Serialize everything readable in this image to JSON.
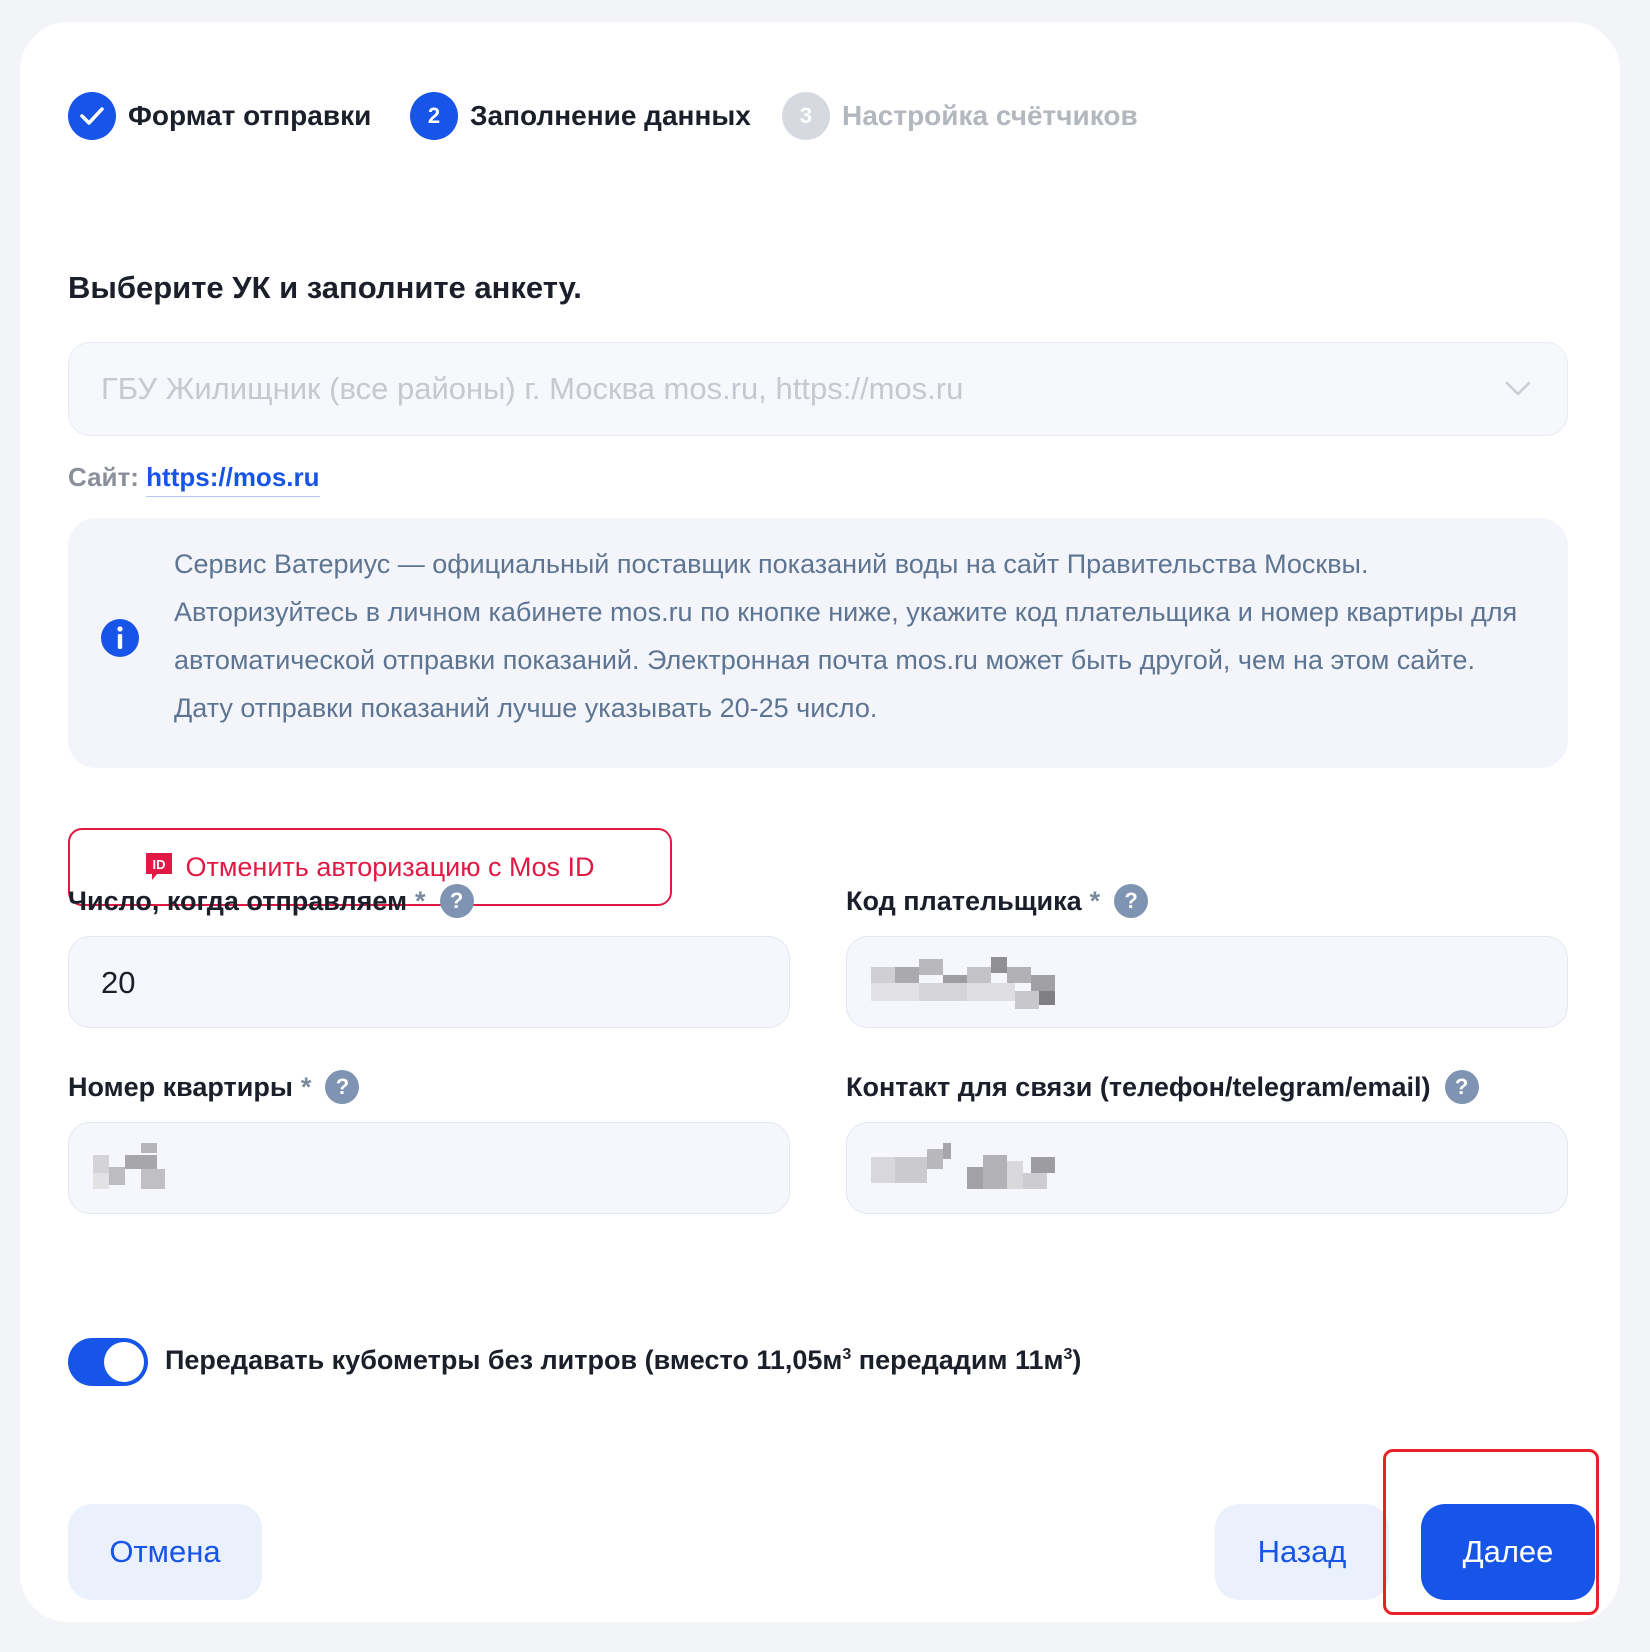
{
  "stepper": {
    "steps": [
      {
        "number": "",
        "label": "Формат отправки",
        "state": "done"
      },
      {
        "number": "2",
        "label": "Заполнение данных",
        "state": "active"
      },
      {
        "number": "3",
        "label": "Настройка счётчиков",
        "state": "pending"
      }
    ]
  },
  "form": {
    "heading": "Выберите УК и заполните анкету.",
    "company_select": {
      "value": "ГБУ Жилищник (все районы) г. Москва mos.ru, https://mos.ru"
    },
    "site": {
      "label": "Сайт:",
      "link": "https://mos.ru"
    },
    "info_text": "Сервис Ватериус — официальный поставщик показаний воды на сайт Правительства Москвы. Авторизуйтесь в личном кабинете mos.ru по кнопке ниже, укажите код плательщика и номер квартиры для автоматической отправки показаний. Электронная почта mos.ru может быть другой, чем на этом сайте. Дату отправки показаний лучше указывать 20-25 число.",
    "mos_id_button": {
      "icon_text": "ID",
      "label": "Отменить авторизацию с Mos ID"
    },
    "fields": {
      "send_day": {
        "label": "Число, когда отправляем",
        "required": "*",
        "value": "20"
      },
      "payer_code": {
        "label": "Код плательщика",
        "required": "*"
      },
      "apartment": {
        "label": "Номер квартиры",
        "required": "*"
      },
      "contact": {
        "label": "Контакт для связи (телефон/telegram/email)"
      }
    },
    "help_glyph": "?",
    "toggle": {
      "state": "on",
      "label_part1": "Передавать кубометры без литров (вместо 11,05м",
      "sup1": "3",
      "label_part2": " передадим 11м",
      "sup2": "3",
      "label_part3": ")"
    }
  },
  "actions": {
    "cancel": "Отмена",
    "back": "Назад",
    "next": "Далее"
  },
  "colors": {
    "accent": "#1754e8",
    "danger": "#e01a45",
    "highlight_border": "#e82029"
  }
}
